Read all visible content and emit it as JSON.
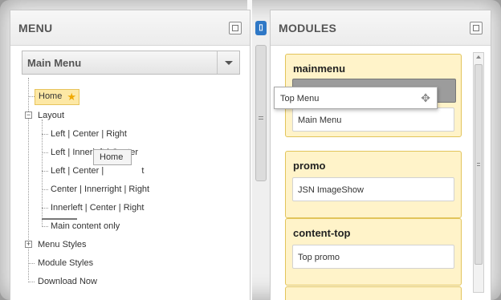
{
  "menu_panel": {
    "title": "MENU",
    "select_value": "Main Menu",
    "tree": [
      {
        "label": "Home",
        "level": 0,
        "starred": true,
        "selected": true
      },
      {
        "label": "Layout",
        "level": 0,
        "expander": "minus"
      },
      {
        "label": "Left | Center | Right",
        "level": 1
      },
      {
        "label": "Left | Innerleft | Center",
        "level": 1
      },
      {
        "label": "Left | Center | ",
        "level": 1
      },
      {
        "label": "Center | Innerright | Right",
        "level": 1
      },
      {
        "label": "Innerleft | Center | Right",
        "level": 1
      },
      {
        "label": "Main content only",
        "level": 1
      },
      {
        "label": "Menu Styles",
        "level": 0,
        "expander": "plus"
      },
      {
        "label": "Module Styles",
        "level": 0
      },
      {
        "label": "Download Now",
        "level": 0
      }
    ],
    "drag_ghost": "Home",
    "partial_suffix": "t"
  },
  "modules_panel": {
    "title": "MODULES",
    "positions": [
      {
        "name": "mainmenu",
        "items": [
          "Main Menu"
        ]
      },
      {
        "name": "promo",
        "items": [
          "JSN ImageShow"
        ]
      },
      {
        "name": "content-top",
        "items": [
          "Top promo"
        ]
      }
    ],
    "dragging_item": "Top Menu"
  },
  "icons": {
    "maximize": "maximize-icon",
    "star": "star-icon",
    "move": "move-icon",
    "dropdown": "chevron-down-icon"
  },
  "colors": {
    "module_bg": "#fff3c9",
    "module_border": "#e2c45a",
    "selected_bg": "#fde8a5",
    "accent_blue": "#2f78c6"
  }
}
